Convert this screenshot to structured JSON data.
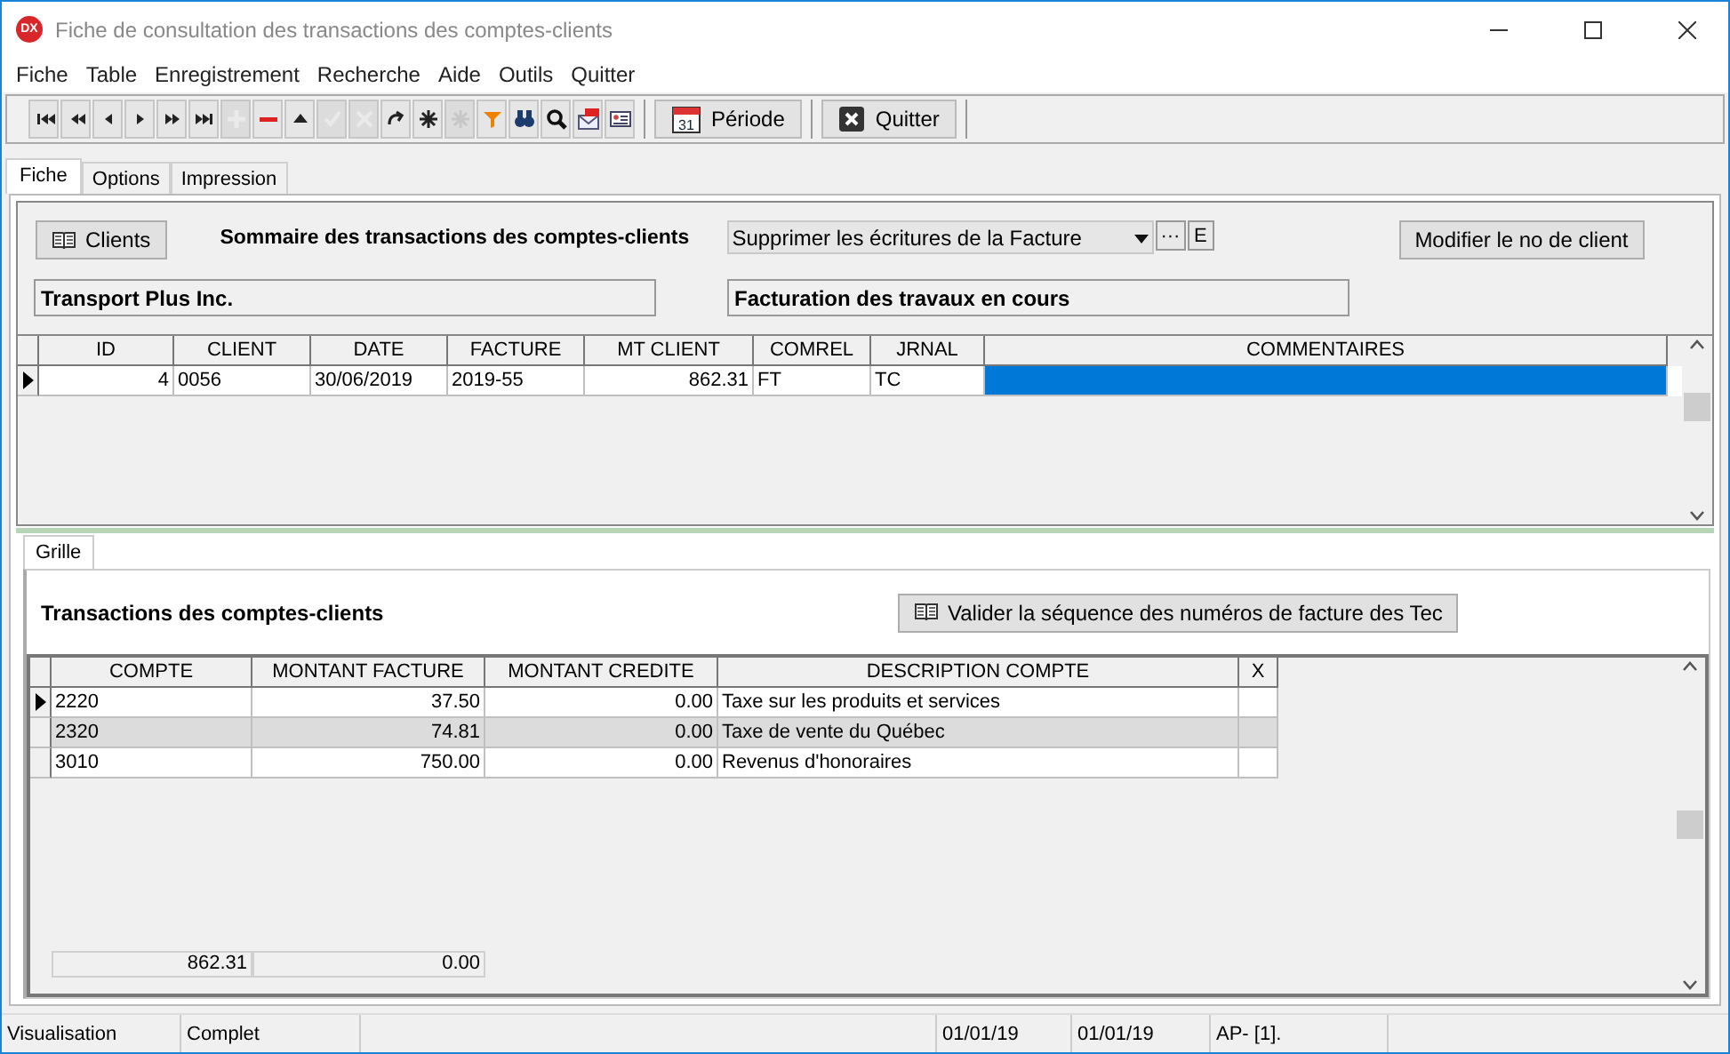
{
  "window": {
    "title": "Fiche de consultation des transactions des comptes-clients",
    "app_badge": "DX"
  },
  "menu": [
    "Fiche",
    "Table",
    "Enregistrement",
    "Recherche",
    "Aide",
    "Outils",
    "Quitter"
  ],
  "toolbar": [
    {
      "kind": "first",
      "disabled": false
    },
    {
      "kind": "prev-page",
      "disabled": false
    },
    {
      "kind": "prev",
      "disabled": false
    },
    {
      "kind": "next",
      "disabled": false
    },
    {
      "kind": "next-page",
      "disabled": false
    },
    {
      "kind": "last",
      "disabled": false
    },
    {
      "kind": "add",
      "disabled": true
    },
    {
      "kind": "delete",
      "disabled": false
    },
    {
      "kind": "up",
      "disabled": false
    },
    {
      "kind": "confirm",
      "disabled": true
    },
    {
      "kind": "cancel",
      "disabled": true
    },
    {
      "kind": "refresh",
      "disabled": false
    },
    {
      "kind": "star",
      "disabled": false
    },
    {
      "kind": "star",
      "disabled": true
    },
    {
      "kind": "filter",
      "disabled": false
    },
    {
      "kind": "binoculars",
      "disabled": false
    },
    {
      "kind": "search",
      "disabled": false
    },
    {
      "kind": "pdf-mail",
      "disabled": false
    },
    {
      "kind": "card",
      "disabled": false
    }
  ],
  "toolbar_buttons": [
    {
      "kind": "calendar",
      "label": "Période",
      "icon_text": "31"
    },
    {
      "kind": "quit",
      "label": "Quitter"
    }
  ],
  "tabs": [
    {
      "label": "Fiche",
      "selected": true
    },
    {
      "label": "Options",
      "selected": false
    },
    {
      "label": "Impression",
      "selected": false
    }
  ],
  "header": {
    "clients_button": "Clients",
    "title": "Sommaire des transactions des comptes-clients",
    "action_select": "Supprimer les écritures de la Facture",
    "ellipsis_button": "···",
    "e_button": "E",
    "modify_button": "Modifier le no de client",
    "client_name": "Transport Plus Inc.",
    "category": "Facturation des travaux en cours"
  },
  "summary_table": {
    "columns": [
      "ID",
      "CLIENT",
      "DATE",
      "FACTURE",
      "MT CLIENT",
      "COMREL",
      "JRNAL",
      "COMMENTAIRES"
    ],
    "rows": [
      {
        "selected": true,
        "cells": [
          "4",
          "0056",
          "30/06/2019",
          "2019-55",
          "862.31",
          "FT",
          "TC",
          ""
        ]
      }
    ]
  },
  "lower_tabs": [
    {
      "label": "Grille",
      "selected": true
    }
  ],
  "detail": {
    "title": "Transactions  des comptes-clients",
    "validate_button": "Valider la séquence des numéros de facture des Tec",
    "columns": [
      "COMPTE",
      "MONTANT FACTURE",
      "MONTANT CREDITE",
      "DESCRIPTION COMPTE",
      "X"
    ],
    "rows": [
      {
        "selected": true,
        "shaded": false,
        "cells": [
          "2220",
          "37.50",
          "0.00",
          "Taxe sur les produits et services",
          ""
        ]
      },
      {
        "selected": false,
        "shaded": true,
        "cells": [
          "2320",
          "74.81",
          "0.00",
          "Taxe de vente du Québec",
          ""
        ]
      },
      {
        "selected": false,
        "shaded": false,
        "cells": [
          "3010",
          "750.00",
          "0.00",
          "Revenus d'honoraires",
          ""
        ]
      }
    ],
    "totals": [
      "862.31",
      "0.00"
    ]
  },
  "status_bar": {
    "left": [
      "Visualisation",
      "Complet"
    ],
    "right": [
      "01/01/19",
      "01/01/19",
      "AP- [1]."
    ]
  }
}
